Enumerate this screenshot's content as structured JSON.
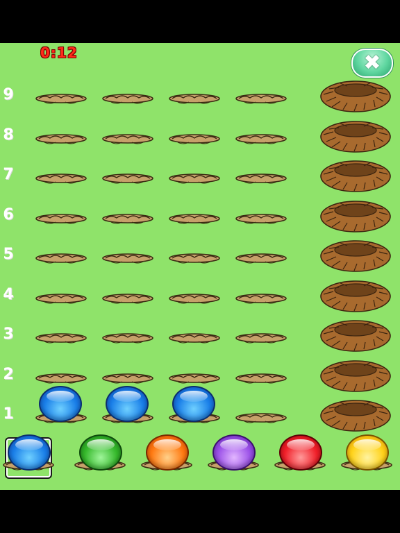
{
  "timer": {
    "text": "0:12"
  },
  "close_button": {
    "icon": "close-x-icon",
    "glyph": "✖"
  },
  "rows": [
    "9",
    "8",
    "7",
    "6",
    "5",
    "4",
    "3",
    "2",
    "1"
  ],
  "pegs_per_row": 4,
  "placed_marbles": [
    {
      "row": "1",
      "slot": 1,
      "color": "blue"
    },
    {
      "row": "1",
      "slot": 2,
      "color": "blue"
    },
    {
      "row": "1",
      "slot": 3,
      "color": "blue"
    }
  ],
  "palette": [
    {
      "color": "blue",
      "selected": true
    },
    {
      "color": "green",
      "selected": false
    },
    {
      "color": "orange",
      "selected": false
    },
    {
      "color": "purple",
      "selected": false
    },
    {
      "color": "red",
      "selected": false
    },
    {
      "color": "yellow",
      "selected": false
    }
  ],
  "colors": {
    "background": "#8fe36a",
    "timer": "#ff2a1a",
    "nest": "#a86a2e",
    "hole": "#c6a16a"
  }
}
